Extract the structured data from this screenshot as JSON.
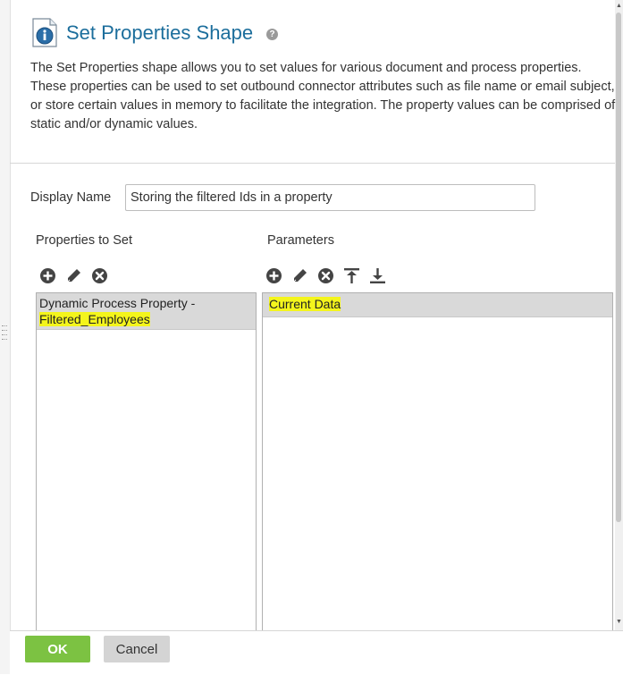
{
  "header": {
    "title": "Set Properties Shape",
    "help_icon": "?",
    "description": "The Set Properties shape allows you to set values for various document and process properties. These properties can be used to set outbound connector attributes such as file name or email subject, or store certain values in memory to facilitate the integration. The property values can be comprised of static and/or dynamic values."
  },
  "display_name": {
    "label": "Display Name",
    "value": "Storing the filtered Ids in a property"
  },
  "properties_panel": {
    "label": "Properties to Set",
    "toolbar": [
      "add-icon",
      "edit-icon",
      "delete-icon"
    ],
    "items": [
      {
        "line1": "Dynamic Process Property -",
        "line2": "Filtered_Employees"
      }
    ]
  },
  "parameters_panel": {
    "label": "Parameters",
    "toolbar": [
      "add-icon",
      "edit-icon",
      "delete-icon",
      "move-top-icon",
      "move-bottom-icon"
    ],
    "items": [
      {
        "label": "Current Data"
      }
    ]
  },
  "footer": {
    "ok_label": "OK",
    "cancel_label": "Cancel"
  },
  "colors": {
    "title": "#1c6e9c",
    "ok_button": "#7cc242",
    "cancel_button": "#d4d4d4",
    "selected_row": "#d9d9d9",
    "highlight": "#f4f51c"
  }
}
